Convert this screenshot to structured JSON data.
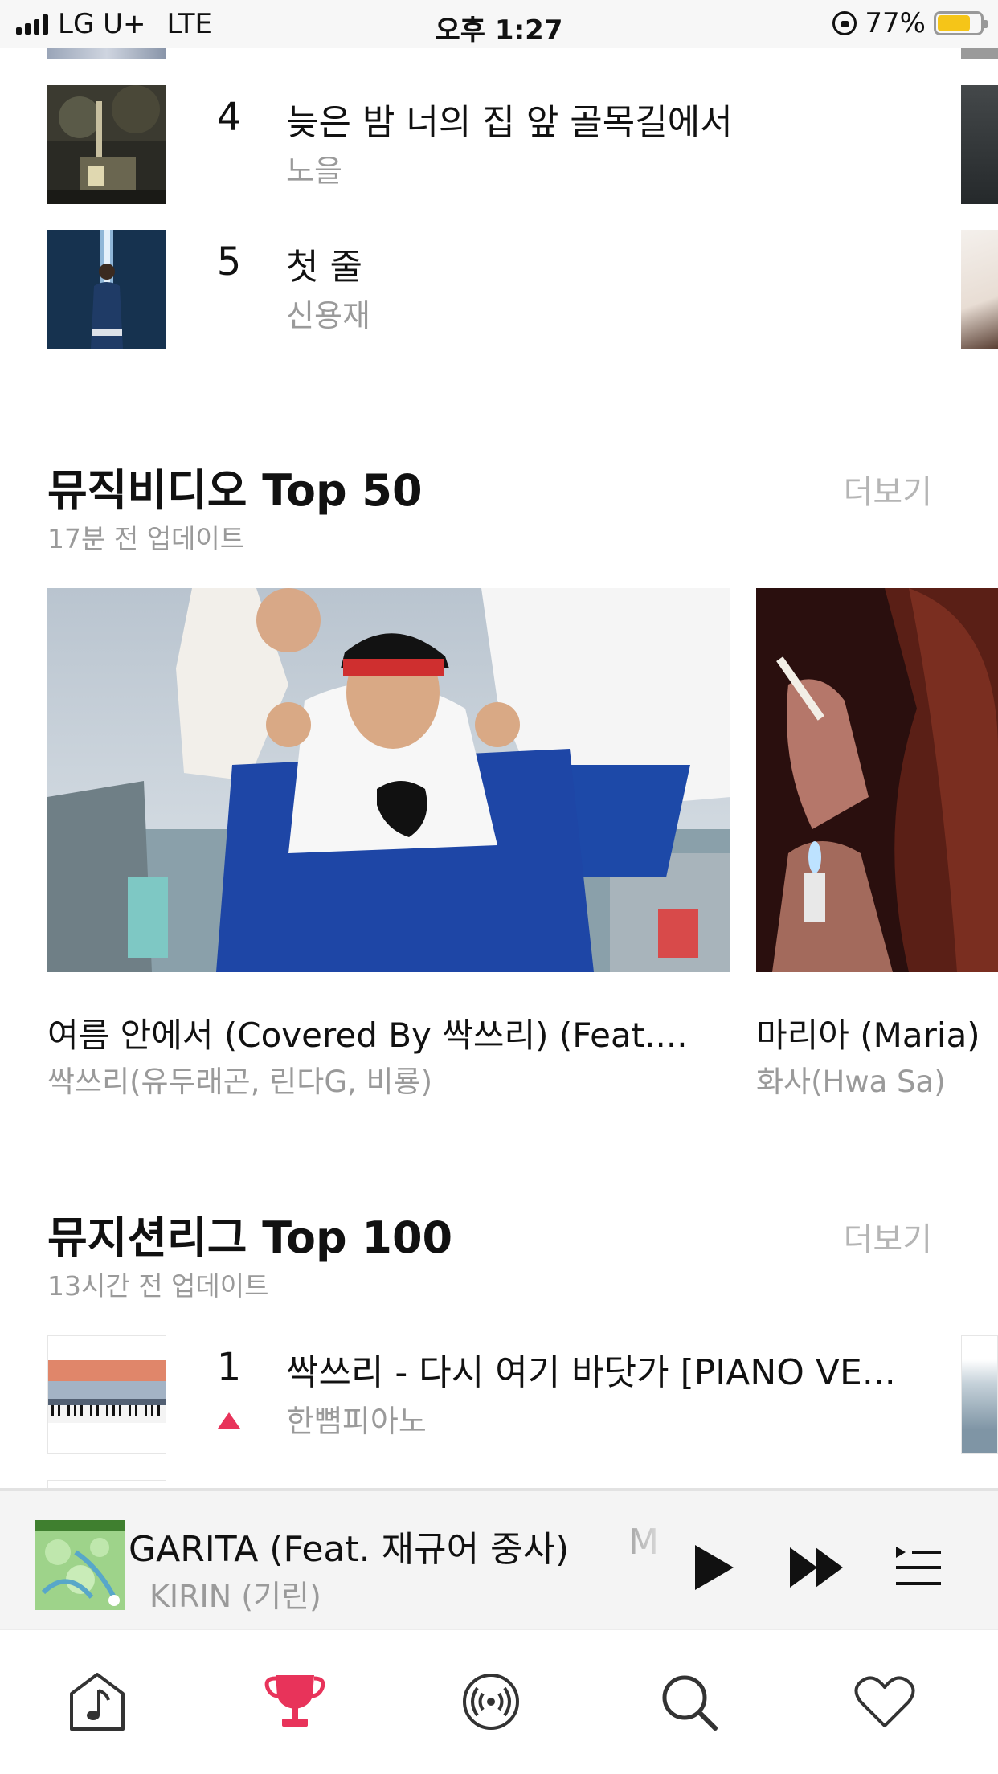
{
  "status_bar": {
    "carrier": "LG U+",
    "network": "LTE",
    "time": "오후 1:27",
    "battery_percent": "77%",
    "battery_level": 0.77,
    "battery_color": "#f5c518"
  },
  "chart_top_list": {
    "rows": [
      {
        "rank": "4",
        "title": "늦은 밤 너의 집 앞 골목길에서",
        "artist": "노을"
      },
      {
        "rank": "5",
        "title": "첫 줄",
        "artist": "신용재"
      }
    ]
  },
  "mv_section": {
    "title": "뮤직비디오 Top 50",
    "updated": "17분 전 업데이트",
    "more": "더보기",
    "videos": [
      {
        "title": "여름 안에서 (Covered By 싹쓰리) (Feat....",
        "artist": "싹쓰리(유두래곤, 린다G, 비룡)"
      },
      {
        "title": "마리아 (Maria)",
        "artist": "화사(Hwa Sa)"
      }
    ]
  },
  "league_section": {
    "title": "뮤지션리그 Top 100",
    "updated": "13시간 전 업데이트",
    "more": "더보기",
    "rows": [
      {
        "rank": "1",
        "title": "싹쓰리 - 다시 여기 바닷가 [PIANO VE...",
        "artist": "한뼘피아노",
        "trend": "up",
        "trend_color": "#e8335a"
      }
    ]
  },
  "now_playing": {
    "title": "GARITA (Feat. 재규어 중사)",
    "artist": "KIRIN (기린)",
    "ghost_text": "M",
    "icons": [
      "play-icon",
      "next-icon",
      "playlist-icon"
    ]
  },
  "tab_bar": {
    "active_color": "#e8335a",
    "tabs": [
      "music-note-icon",
      "trophy-icon",
      "radio-icon",
      "search-icon",
      "heart-icon"
    ],
    "active_index": 1
  }
}
